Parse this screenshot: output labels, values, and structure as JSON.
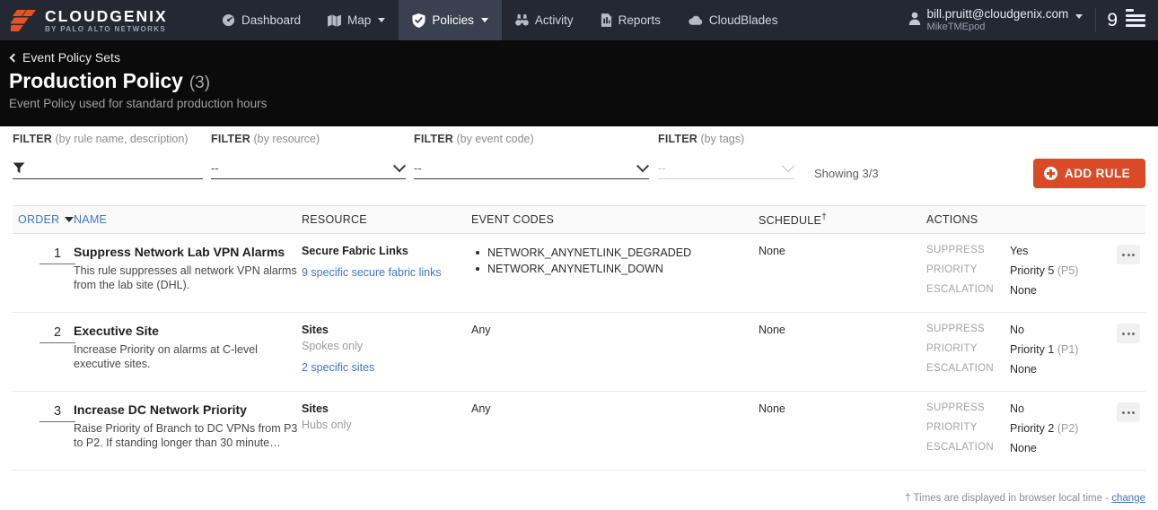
{
  "topnav": {
    "brand_name": "CLOUDGENIX",
    "brand_sub": "BY PALO ALTO NETWORKS",
    "items": [
      {
        "label": "Dashboard",
        "icon": "gauge-icon",
        "caret": false,
        "active": false
      },
      {
        "label": "Map",
        "icon": "map-icon",
        "caret": true,
        "active": false
      },
      {
        "label": "Policies",
        "icon": "shield-check-icon",
        "caret": true,
        "active": true
      },
      {
        "label": "Activity",
        "icon": "binoculars-icon",
        "caret": false,
        "active": false
      },
      {
        "label": "Reports",
        "icon": "report-icon",
        "caret": false,
        "active": false
      },
      {
        "label": "CloudBlades",
        "icon": "cloud-icon",
        "caret": false,
        "active": false
      }
    ],
    "user_email": "bill.pruitt@cloudgenix.com",
    "user_pod": "MikeTMEpod",
    "notification_count": "9"
  },
  "pageheader": {
    "breadcrumb": "Event Policy Sets",
    "title": "Production Policy",
    "count": "(3)",
    "subtitle": "Event Policy used for standard production hours"
  },
  "filters": [
    {
      "label": "FILTER",
      "sub": "(by rule name, description)",
      "kind": "text",
      "value": "",
      "disabled": false
    },
    {
      "label": "FILTER",
      "sub": "(by resource)",
      "kind": "select",
      "value": "--",
      "disabled": false
    },
    {
      "label": "FILTER",
      "sub": "(by event code)",
      "kind": "select",
      "value": "--",
      "disabled": false
    },
    {
      "label": "FILTER",
      "sub": "(by tags)",
      "kind": "select",
      "value": "--",
      "disabled": true
    }
  ],
  "showing": "Showing 3/3",
  "add_rule_label": "ADD RULE",
  "accent_color": "#db4a26",
  "link_color": "#3e74c9",
  "table": {
    "headers": {
      "order": "ORDER",
      "name": "NAME",
      "resource": "RESOURCE",
      "event_codes": "EVENT CODES",
      "schedule": "SCHEDULE",
      "schedule_dagger": "†",
      "actions": "ACTIONS"
    },
    "action_keys": {
      "suppress": "SUPPRESS",
      "priority": "PRIORITY",
      "escalation": "ESCALATION"
    },
    "rows": [
      {
        "order": "1",
        "name": "Suppress Network Lab VPN Alarms",
        "description": "This rule suppresses all network VPN alarms from the lab site (DHL).",
        "resource_type": "Secure Fabric Links",
        "resource_sub": "",
        "resource_link": "9 specific secure fabric links",
        "event_codes": [
          "NETWORK_ANYNETLINK_DEGRADED",
          "NETWORK_ANYNETLINK_DOWN"
        ],
        "event_any": "",
        "schedule": "None",
        "suppress": "Yes",
        "priority": "Priority 5",
        "priority_short": "(P5)",
        "escalation": "None"
      },
      {
        "order": "2",
        "name": "Executive Site",
        "description": "Increase Priority on alarms at C-level executive sites.",
        "resource_type": "Sites",
        "resource_sub": "Spokes only",
        "resource_link": "2 specific sites",
        "event_codes": [],
        "event_any": "Any",
        "schedule": "None",
        "suppress": "No",
        "priority": "Priority 1",
        "priority_short": "(P1)",
        "escalation": "None"
      },
      {
        "order": "3",
        "name": "Increase DC Network Priority",
        "description": "Raise Priority of Branch to DC VPNs from P3 to P2. If standing longer than 30 minute…",
        "resource_type": "Sites",
        "resource_sub": "Hubs only",
        "resource_link": "",
        "event_codes": [],
        "event_any": "Any",
        "schedule": "None",
        "suppress": "No",
        "priority": "Priority 2",
        "priority_short": "(P2)",
        "escalation": "None"
      }
    ]
  },
  "footer": {
    "note": "† Times are displayed in browser local time -",
    "link": "change"
  }
}
